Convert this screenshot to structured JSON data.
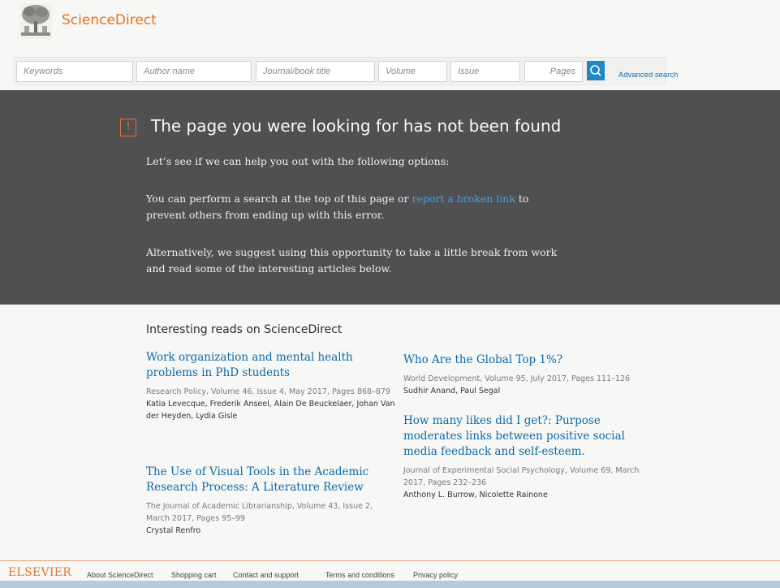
{
  "header": {
    "brand": "ScienceDirect"
  },
  "search": {
    "fields": [
      {
        "name": "keywords-field",
        "placeholder": "Keywords"
      },
      {
        "name": "author-field",
        "placeholder": "Author name"
      },
      {
        "name": "journal-field",
        "placeholder": "Journal/book title"
      },
      {
        "name": "volume-field",
        "placeholder": "Volume"
      },
      {
        "name": "issue-field",
        "placeholder": "Issue"
      },
      {
        "name": "pages-field",
        "placeholder": "Pages"
      }
    ],
    "button_icon": "search-icon",
    "advanced_label": "Advanced search"
  },
  "error": {
    "icon": "!",
    "title": "The page you were looking for has not been found",
    "intro": "Let’s see if we can help you out with the following options:",
    "search_pre": "You can perform a search at the top of this page or ",
    "search_link": "report a broken link",
    "search_post": " to prevent others from ending up with this error.",
    "alternative": "Alternatively, we suggest using this opportunity to take a little break from work and read some of the interesting articles below."
  },
  "reads": {
    "heading": "Interesting reads on ScienceDirect",
    "articles": [
      {
        "title": "Work organization and mental health problems in PhD students",
        "source": "Research Policy, Volume 46, Issue 4, May 2017, Pages 868–879",
        "authors": "Katia Levecque, Frederik Anseel, Alain De Beuckelaer, Johan Van der Heyden, Lydia Gisle"
      },
      {
        "title": "The Use of Visual Tools in the Academic Research Process: A Literature Review",
        "source": "The Journal of Academic Librarianship, Volume 43, Issue 2, March 2017, Pages 95–99",
        "authors": "Crystal Renfro"
      },
      {
        "title": "Who Are the Global Top 1%?",
        "source": "World Development, Volume 95, July 2017, Pages 111–126",
        "authors": "Sudhir Anand, Paul Segal"
      },
      {
        "title": "How many likes did I get?: Purpose moderates links between positive social media feedback and self-esteem.",
        "source": "Journal of Experimental Social Psychology, Volume 69, March 2017, Pages 232–236",
        "authors": "Anthony L. Burrow, Nicolette Rainone"
      }
    ]
  },
  "footer": {
    "brand": "ELSEVIER",
    "links": [
      "About ScienceDirect",
      "Shopping cart",
      "Contact and support",
      "Terms and conditions",
      "Privacy policy"
    ]
  },
  "colors": {
    "accent_orange": "#e8732e",
    "link_blue": "#0c6aa8",
    "hero_bg": "#505052",
    "search_button": "#1e88c8"
  }
}
